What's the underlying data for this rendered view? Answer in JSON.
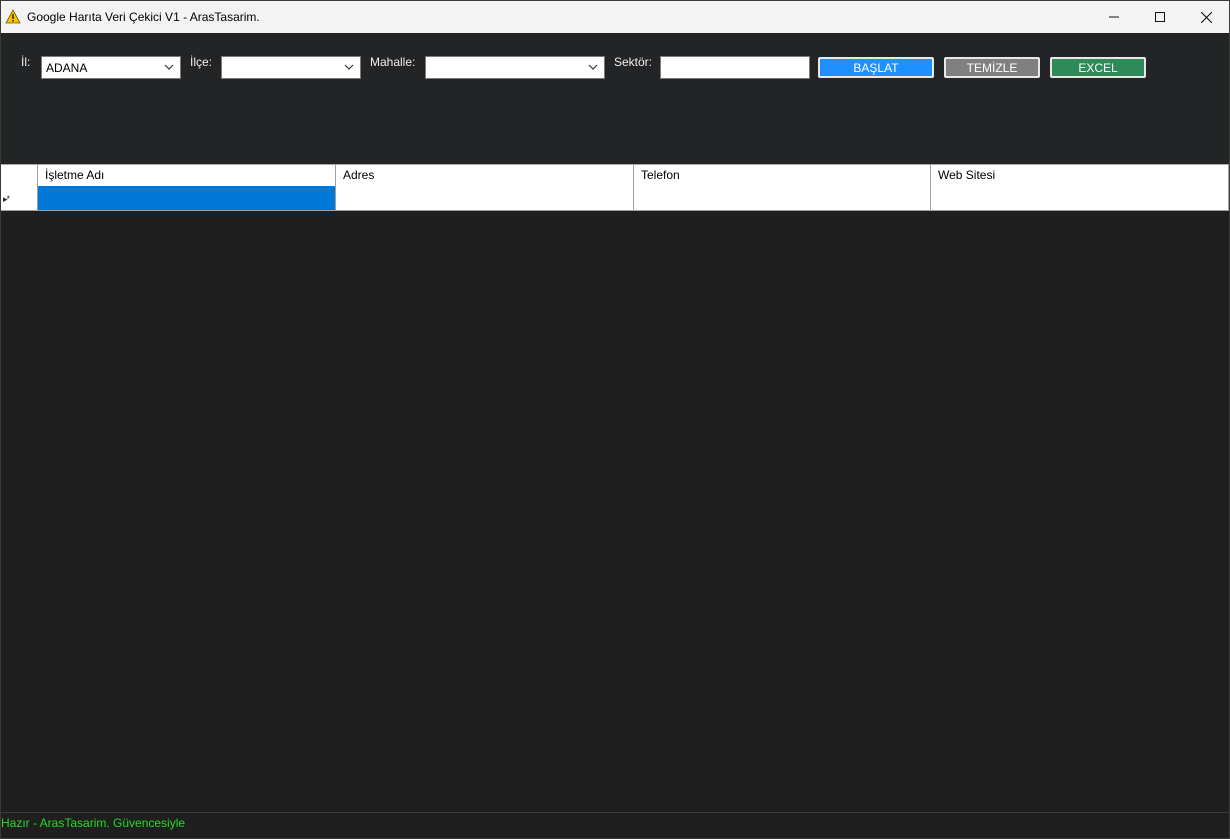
{
  "window": {
    "title": "Google Harıta Veri Çekici V1 - ArasTasarim.",
    "icon": "warning-icon",
    "controls": [
      "minimize-icon",
      "maximize-icon",
      "close-icon"
    ]
  },
  "filters": {
    "il_label": "İl:",
    "il_value": "ADANA",
    "ilce_label": "İlçe:",
    "ilce_value": "",
    "mahalle_label": "Mahalle:",
    "mahalle_value": "",
    "sektor_label": "Sektör:",
    "sektor_value": ""
  },
  "buttons": {
    "start_label": "BAŞLAT",
    "start_color": "#1e90ff",
    "clear_label": "TEMİZLE",
    "clear_color": "#808080",
    "excel_label": "EXCEL",
    "excel_color": "#2e8b57"
  },
  "grid": {
    "columns": [
      "İşletme Adı",
      "Adres",
      "Telefon",
      "Web Sitesi"
    ],
    "new_row_marker": "▸*",
    "selected_color": "#0078d7"
  },
  "status": {
    "text": "Hazır - ArasTasarim. Güvencesiyle",
    "color": "#22dd22"
  }
}
